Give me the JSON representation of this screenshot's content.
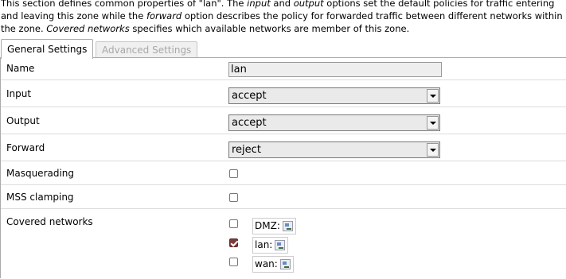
{
  "description": {
    "part1": "This section defines common properties of \"lan\". The ",
    "em1": "input",
    "part2": " and ",
    "em2": "output",
    "part3": " options set the default policies for traffic entering and leaving this zone while the ",
    "em3": "forward",
    "part4": " option describes the policy for forwarded traffic between different networks within the zone. ",
    "em4": "Covered networks",
    "part5": " specifies which available networks are member of this zone."
  },
  "tabs": [
    {
      "label": "General Settings",
      "active": true
    },
    {
      "label": "Advanced Settings",
      "active": false
    }
  ],
  "fields": {
    "name": {
      "label": "Name",
      "value": "lan"
    },
    "input": {
      "label": "Input",
      "value": "accept"
    },
    "output": {
      "label": "Output",
      "value": "accept"
    },
    "forward": {
      "label": "Forward",
      "value": "reject"
    },
    "masquerading": {
      "label": "Masquerading",
      "checked": false
    },
    "mss_clamping": {
      "label": "MSS clamping",
      "checked": false
    },
    "covered_networks": {
      "label": "Covered networks",
      "networks": [
        {
          "name": "DMZ:",
          "checked": false,
          "icon": "network-interface-icon"
        },
        {
          "name": "lan:",
          "checked": true,
          "icon": "network-interface-icon"
        },
        {
          "name": "wan:",
          "checked": false,
          "icon": "network-interface-icon"
        }
      ]
    }
  },
  "colors": {
    "checked_box": "#7a3b3b",
    "inactive_tab_text": "#a8a8a8"
  }
}
